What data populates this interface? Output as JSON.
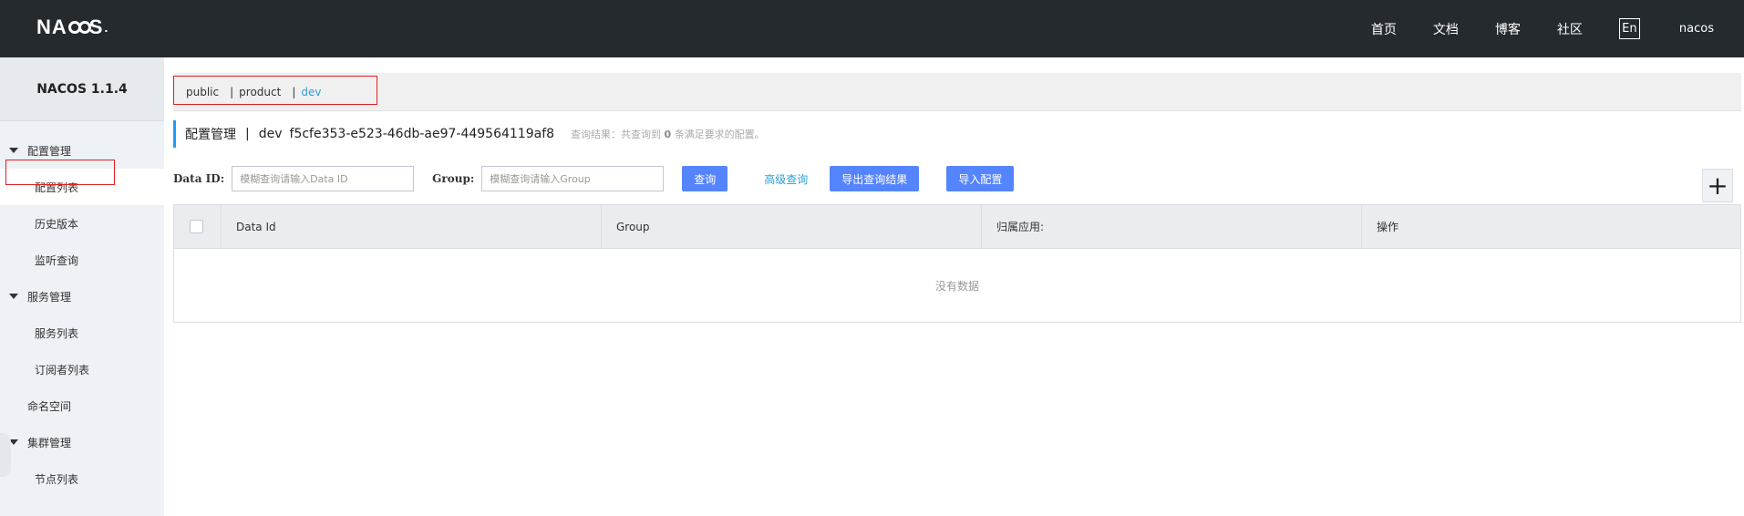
{
  "header": {
    "logo_text": "NACOS",
    "nav": [
      "首页",
      "文档",
      "博客",
      "社区"
    ],
    "lang_button": "En",
    "user": "nacos"
  },
  "sidebar": {
    "version": "NACOS 1.1.4",
    "groups": [
      {
        "label": "配置管理",
        "items": [
          "配置列表",
          "历史版本",
          "监听查询"
        ]
      },
      {
        "label": "服务管理",
        "items": [
          "服务列表",
          "订阅者列表"
        ]
      },
      {
        "label": "命名空间"
      },
      {
        "label": "集群管理",
        "items": [
          "节点列表"
        ]
      }
    ]
  },
  "namespaces": {
    "items": [
      "public",
      "product",
      "dev"
    ],
    "active": "dev"
  },
  "heading": {
    "title": "配置管理",
    "namespace_name": "dev",
    "namespace_id": "f5cfe353-e523-46db-ae97-449564119af8",
    "result_prefix": "查询结果：共查询到",
    "result_count": "0",
    "result_suffix": "条满足要求的配置。"
  },
  "filter": {
    "data_id_label": "Data ID:",
    "data_id_placeholder": "模糊查询请输入Data ID",
    "group_label": "Group:",
    "group_placeholder": "模糊查询请输入Group",
    "query_button": "查询",
    "advanced_query": "高级查询",
    "export_button": "导出查询结果",
    "import_button": "导入配置",
    "add_button": "+"
  },
  "table": {
    "columns": [
      "Data Id",
      "Group",
      "归属应用:",
      "操作"
    ],
    "empty_text": "没有数据"
  },
  "colors": {
    "topbar": "#252a2f",
    "primary_button": "#5584ff",
    "link": "#2e9fd6",
    "highlight_box": "#e02020"
  }
}
